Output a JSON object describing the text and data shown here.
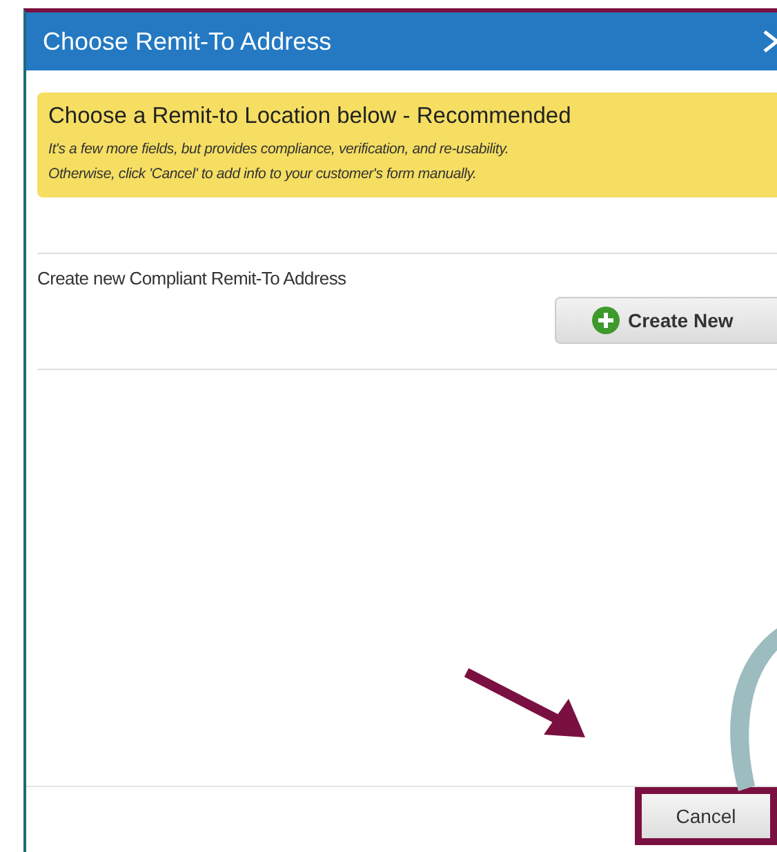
{
  "dialog": {
    "title": "Choose Remit-To Address"
  },
  "notice": {
    "heading": "Choose a Remit-to Location below - Recommended",
    "lines": [
      "It's a few more fields, but provides compliance, verification, and re-usability.",
      "Otherwise, click 'Cancel' to add info to your customer's form manually."
    ]
  },
  "create_section": {
    "label": "Create new Compliant Remit-To Address",
    "button": "Create New"
  },
  "footer": {
    "button": "Cancel",
    "highlighted": true
  }
}
